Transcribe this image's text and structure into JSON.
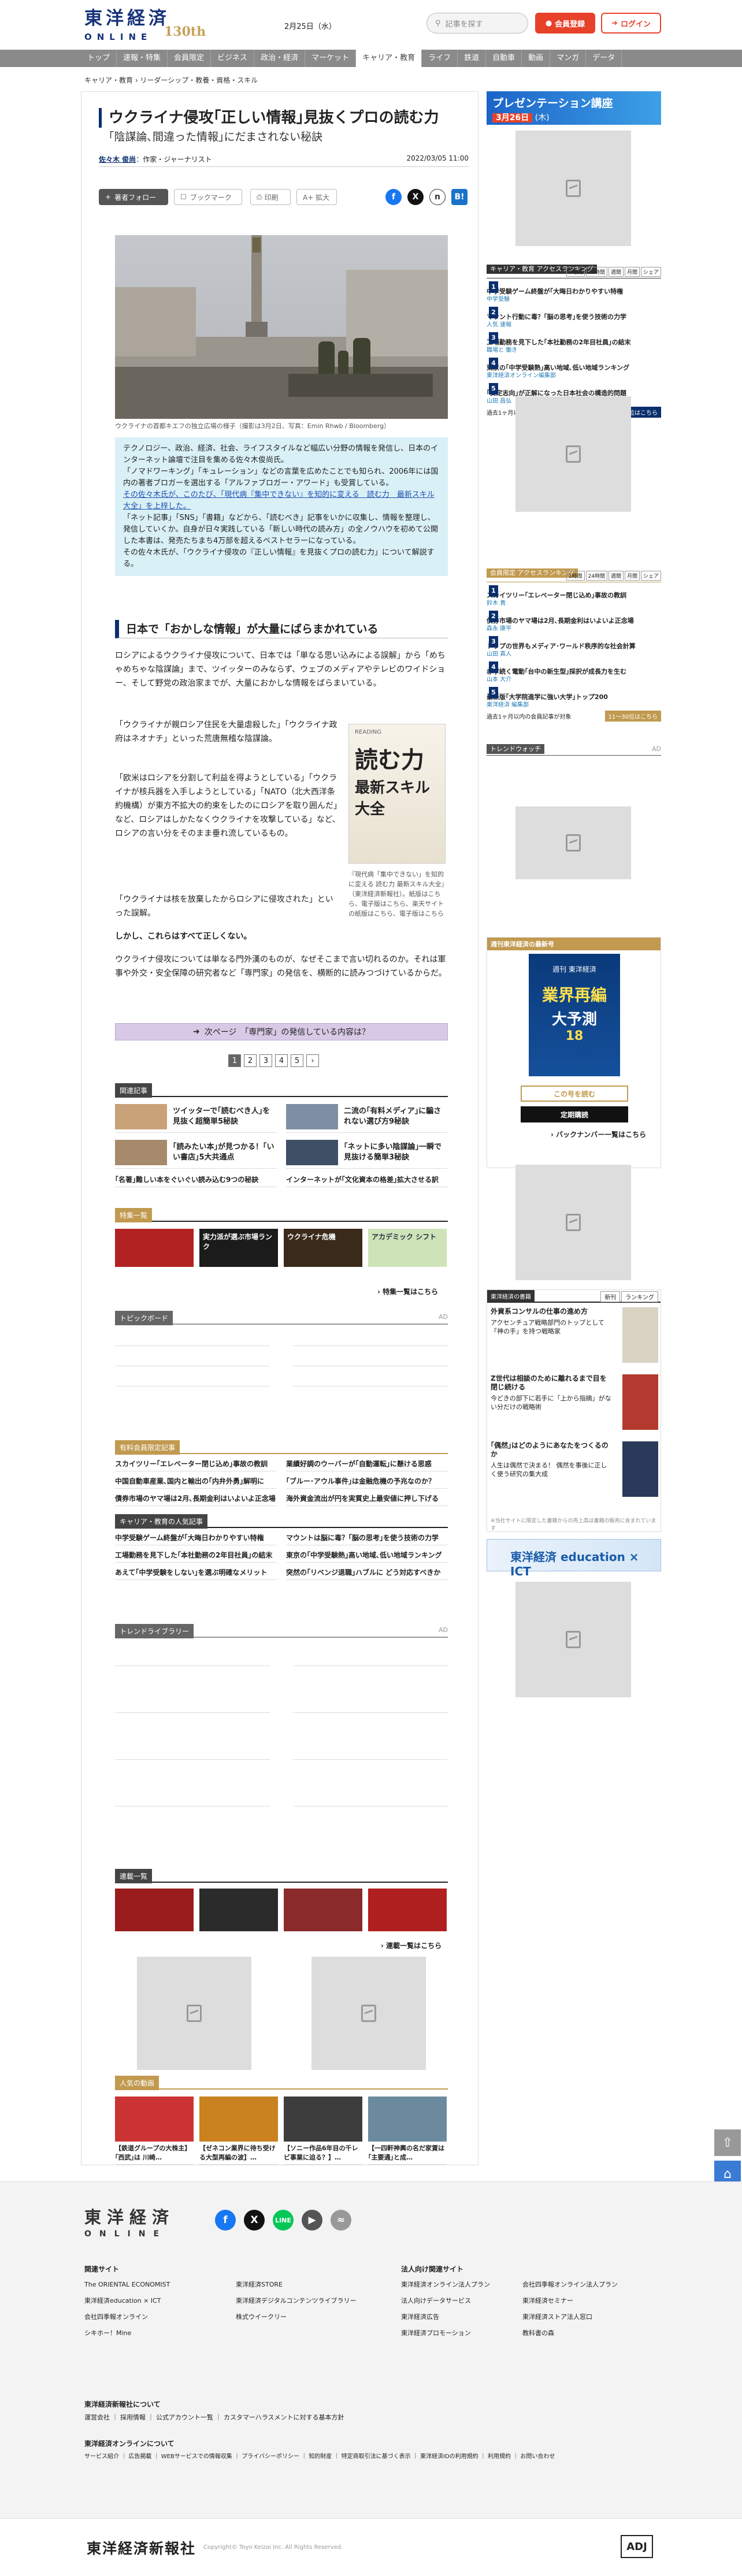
{
  "header": {
    "logo_main": "東洋経済",
    "logo_sub": "ONLINE",
    "logo_anniv": "130th",
    "date": "2月25日（水）",
    "search_placeholder": "記事を探す",
    "register_label": "会員登録",
    "login_label": "ログイン"
  },
  "nav": [
    "トップ",
    "速報・特集",
    "会員限定",
    "ビジネス",
    "政治・経済",
    "マーケット",
    "キャリア・教育",
    "ライフ",
    "鉄道",
    "自動車",
    "動画",
    "マンガ",
    "データ"
  ],
  "breadcrumb": "キャリア・教育 › リーダーシップ・教養・資格・スキル",
  "article": {
    "title": "ウクライナ侵攻｢正しい情報｣見抜くプロの読む力",
    "subtitle": "｢陰謀論､間違った情報｣にだまされない秘訣",
    "author": "佐々木 俊尚",
    "author_role": "：作家・ジャーナリスト",
    "pubdate": "2022/03/05 11:00",
    "toolbar": {
      "follow": "著者フォロー",
      "bookmark": "ブックマーク",
      "print": "印刷",
      "fontsize": "A+ 拡大"
    },
    "caption": "ウクライナの首都キエフの独立広場の様子（撮影は3月2日、写真：Emin Rhwb / Bloomberg）",
    "summary": [
      "テクノロジー、政治、経済、社会、ライフスタイルなど幅広い分野の情報を発信し、日本のインターネット論壇で注目を集める佐々木俊尚氏。",
      "「ノマドワーキング」「キュレーション」などの言葉を広めたことでも知られ、2006年には国内の著者ブロガーを選出する「アルファブロガー・アワード」も受賞している。",
      "その佐々木氏が、このたび、「現代病『集中できない』を知的に変える　読む力　最新スキル大全」を上梓した。",
      "「ネット記事」「SNS」「書籍」などから、「読むべき」記事をいかに収集し、情報を整理し、発信していくか。自身が日々実践している「新しい時代の読み方」の全ノウハウを初めて公開した本書は、発売たちまち4万部を超えるベストセラーになっている。",
      "その佐々木氏が、「ウクライナ侵攻の『正しい情報』を見抜くプロの読む力」について解説する。"
    ],
    "h2": "日本で「おかしな情報」が大量にばらまかれている",
    "body": [
      "ロシアによるウクライナ侵攻について、日本では「単なる思い込みによる誤解」から「めちゃめちゃな陰謀論」まで、ツイッターのみならず、ウェブのメディアやテレビのワイドショー、そして野党の政治家までが、大量におかしな情報をばらまいている。",
      "「ウクライナが親ロシア住民を大量虐殺した」「ウクライナ政府はネオナチ」といった荒唐無稽な陰謀論。",
      "「欧米はロシアを分割して利益を得ようとしている」「ウクライナが核兵器を入手しようとしている」「NATO（北大西洋条約機構）が東方不拡大の約束をしたのにロシアを取り囲んだ」など、ロシアはしかたなくウクライナを攻撃している」など、ロシアの言い分をそのまま垂れ流しているもの。",
      "「ウクライナは核を放棄したからロシアに侵攻された」といった誤解。",
      "しかし、これらはすべて正しくない。",
      "ウクライナ侵攻については単なる門外漢のものが、なぜそこまで言い切れるのか。それは軍事や外交・安全保障の研究者など「専門家」の発信を、横断的に読みつづけているからだ。"
    ],
    "book": {
      "tag": "READING",
      "title1": "読む力",
      "title2": "最新スキル大全"
    },
    "book_caption": "『現代病「集中できない」を知的に変える 読む力 最新スキル大全』（東洋経済新報社）。紙版はこちら、電子版はこちら、楽天サイトの紙版はこちら、電子版はこちら",
    "next_page": "次ページ　「専門家」の発信している内容は？",
    "pages": [
      "1",
      "2",
      "3",
      "4",
      "5",
      "›"
    ]
  },
  "related": {
    "label": "関連記事",
    "items": [
      "ツイッターで｢読むべき人｣を見抜く超簡単5秘訣",
      "二流の｢有料メディア｣に騙されない選び方9秘訣",
      "｢読みたい本｣が見つかる！｢いい書店｣5大共通点",
      "｢ネットに多い陰謀論｣一瞬で見抜ける簡単3秘訣"
    ],
    "text_items": [
      "｢名著｣難しい本をぐいぐい読み込む9つの秘訣",
      "インターネットが｢文化資本の格差｣拡大させる訳"
    ]
  },
  "tokushu": {
    "label": "特集一覧",
    "items": [
      "",
      "実力派が選ぶ市場ランク",
      "ウクライナ危機",
      "アカデミック シフト"
    ],
    "more": "特集一覧はこちら"
  },
  "topicboard": {
    "label": "トピックボード",
    "ad": "AD"
  },
  "paid_rank": {
    "label": "有料会員限定記事",
    "items": [
      "スカイツリー｢エレベーター閉じ込め｣事故の教訓",
      "業績好調のウーバーが｢自動運転｣に懸ける思惑",
      "中国自動車産業､国内と輸出の｢内弁外勇｣解明に",
      "｢ブルー･アウル事件｣は金融危機の予兆なのか？",
      "債券市場のヤマ場は2月､長期金利はいよいよ正念場",
      "海外資金流出が円を実質史上最安値に押し下げる"
    ]
  },
  "career_rank": {
    "label": "キャリア・教育の人気記事",
    "items": [
      "中学受験ゲーム終盤が｢大晦日わかりやすい特権",
      "マウントは脳に毒？｢脳の思考｣を使う技術の力学",
      "工場勤務を見下した｢本社勤務の2年目社員｣の結末",
      "東京の｢中学受験熱｣高い地域､低い地域ランキング",
      "あえて｢中学受験をしない｣を選ぶ明確なメリット",
      "突然の｢リベンジ退職｣ハブルに どう対応すべきか"
    ]
  },
  "trend_library": {
    "label": "トレンドライブラリー",
    "ad": "AD"
  },
  "rensai": {
    "label": "連載一覧",
    "more": "連載一覧はこちら"
  },
  "popular": {
    "label": "人気の動画",
    "items": [
      "【鉄道グループの大株主】｢西武｣は 川崎…",
      "【ゼネコン業界に待ち受ける大型再編の波】…",
      "【ソニー作品6年目の千レビ事業に迫る？】…",
      "【一四軒神輿の名だ家賃は｢主要通｣と成…"
    ]
  },
  "sidebar": {
    "pres_title": "プレゼンテーション講座",
    "pres_date": "3月26日",
    "pres_day": "(木)",
    "rank1": {
      "title": "キャリア・教育 アクセスランキング",
      "tabs": [
        "1時間",
        "24時間",
        "週間",
        "月間",
        "シェア"
      ],
      "items": [
        {
          "n": "1",
          "t": "中学受験ゲーム終盤が｢大晦日わかりやすい特権",
          "s": "中学受験"
        },
        {
          "n": "2",
          "t": "マウント行動に毒？｢脳の思考｣を使う技術の力学",
          "s": "人気 速報"
        },
        {
          "n": "3",
          "t": "工場勤務を見下した｢本社勤務の2年目社員｣の結末",
          "s": "職場と 働き"
        },
        {
          "n": "4",
          "t": "東京の｢中学受験熱｣高い地域､低い地域ランキング",
          "s": "東洋経済オンライン編集部"
        },
        {
          "n": "5",
          "t": "｢安定志向｣が正解になった日本社会の構造的問題",
          "s": "山田 昌弘"
        }
      ],
      "foot": "過去1ヶ月以内の記事が対象",
      "btn": "11〜30位はこちら"
    },
    "rank2": {
      "title": "会員限定 アクセスランキング",
      "tabs": [
        "1時間",
        "24時間",
        "週間",
        "月間",
        "シェア"
      ],
      "items": [
        {
          "n": "1",
          "t": "スカイツリー｢エレベーター閉じ込め｣事故の教訓",
          "s": "鈴木 貴"
        },
        {
          "n": "2",
          "t": "債券市場のヤマ場は2月､長期金利はいよいよ正念場",
          "s": "森永 康平"
        },
        {
          "n": "3",
          "t": "トップの世界もメディア･ワールド秩序的な社会計算",
          "s": "山田 真人"
        },
        {
          "n": "4",
          "t": "赤字続く電動｢台中の新生型｣採択が成長力を生む",
          "s": "山本 大介"
        },
        {
          "n": "5",
          "t": "最新版｢大学院進学に強い大学｣トップ200",
          "s": "東洋経済 編集部"
        }
      ],
      "foot": "過去1ヶ月以内の会員記事が対象",
      "btn": "11〜30位はこちら"
    },
    "trend_label": "トレンドウォッチ",
    "trend_ad": "AD",
    "magazine": {
      "label": "週刊東洋経済の最新号",
      "cover_top": "週刊 東洋経済",
      "cover_main": "業界再編",
      "cover_main2": "大予測",
      "cover_no": "18",
      "btn1": "この号を読む",
      "btn2": "定期購読",
      "back": "バックナンバー一覧はこちら"
    },
    "books": {
      "label": "東洋経済の書籍",
      "tabs": [
        "新刊",
        "ランキング"
      ],
      "items": [
        {
          "t": "外資系コンサルの仕事の進め方",
          "d": "アクセンチュア戦略部門のトップとして「神の手」を持つ戦略家"
        },
        {
          "t": "Z世代は相談のために離れるまで目を閉じ続ける",
          "d": "今どきの部下に若手に「上から指摘」がない分だけの戦略術"
        },
        {
          "t": "｢偶然｣はどのようにあなたをつくるのか",
          "d": "人生は偶然で決まる！ 偶然を事後に正しく使う研究の集大成"
        }
      ],
      "foot": "※当社サイトに限定した書籍からの売上高は書籍の販売に含まれています"
    },
    "edu": "東洋経済 education × ICT"
  },
  "footer": {
    "logo_main": "東洋経済",
    "logo_sub": "ONLINE",
    "h1": "関連サイト",
    "h2": "法人向け関連サイト",
    "col1": [
      "The ORIENTAL ECONOMIST",
      "東洋経済education × ICT",
      "会社四季報オンライン",
      "シキホー！Mine"
    ],
    "col2": [
      "東洋経済STORE",
      "東洋経済デジタルコンテンツライブラリー",
      "株式ウイークリー"
    ],
    "col3": [
      "東洋経済オンライン法人プラン",
      "法人向けデータサービス",
      "東洋経済広告",
      "東洋経済プロモーション"
    ],
    "col4": [
      "会社四季報オンライン法人プラン",
      "東洋経済セミナー",
      "東洋経済ストア法人窓口",
      "教科書の森"
    ],
    "about": "東洋経済新報社について",
    "about_links": "運営会社 ｜ 採用情報 ｜ 公式アカウント一覧 ｜ カスタマーハラスメントに対する基本方針",
    "online": "東洋経済オンラインについて",
    "online_links": "サービス紹介 ｜ 広告掲載 ｜ WEBサービスでの情報収集 ｜ プライバシーポリシー ｜ 知的財産 ｜ 特定商取引法に基づく表示 ｜ 東洋経済IDの利用規約 ｜ 利用規約 ｜ お問い合わせ",
    "brand": "東洋経済新報社",
    "copyright": "Copyright© Toyo Keizai Inc. All Rights Reserved.",
    "adj": "ADJ"
  }
}
